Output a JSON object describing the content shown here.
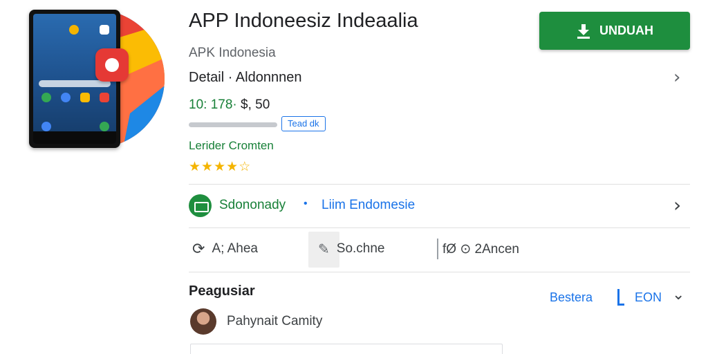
{
  "app": {
    "title": "APP Indoneesiz Indeaalia",
    "developer": "APK Indonesia",
    "detail": "Detail · Aldonnnen",
    "price_highlight": "10: 178·",
    "price_rest": "$, 50",
    "read_chip": "Tead dk",
    "category": "Lerider Cromten",
    "rating_stars": 4,
    "rating_max": 5,
    "progress": 1.0
  },
  "actions": {
    "install_label": "UNDUAH"
  },
  "publisher": {
    "name": "Sdononady",
    "dot": "•",
    "region": "Liim Endomesie"
  },
  "stats": [
    {
      "icon": "refresh-icon",
      "label": "A; Ahea"
    },
    {
      "icon": "edit-icon",
      "label": "So.chne"
    },
    {
      "icon": "timer-icon",
      "label": "fØ ⊙ 2Ancen"
    }
  ],
  "section": {
    "title": "Peagusiar",
    "link_label": "Bestera",
    "lang_label": "EON"
  },
  "review": {
    "author": "Pahynait Camity"
  },
  "colors": {
    "accent_green": "#1e8e3e",
    "link_blue": "#1a73e8",
    "star_gold": "#f4b400"
  }
}
